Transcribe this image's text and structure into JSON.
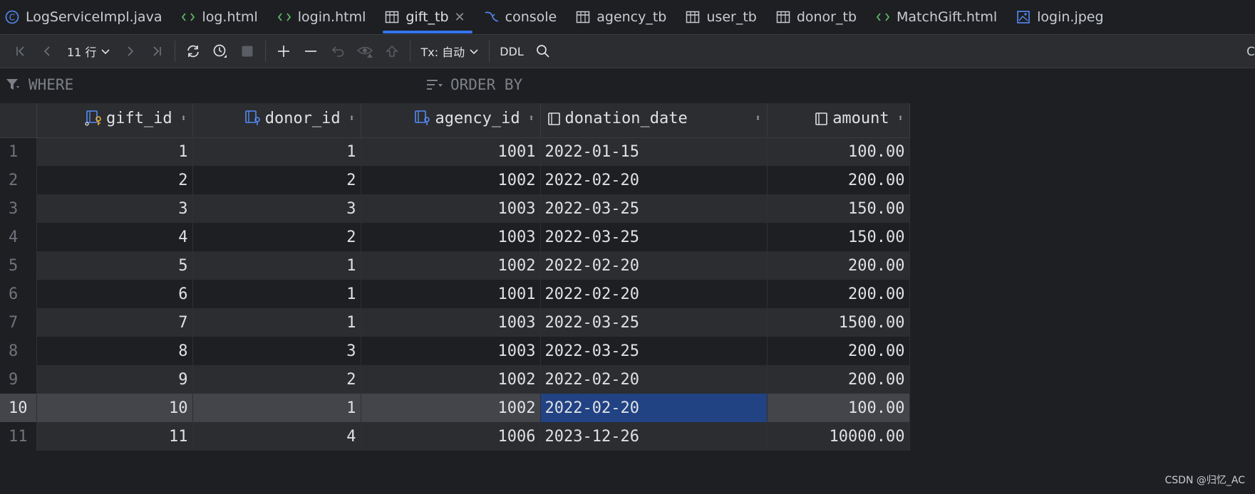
{
  "tabs": [
    {
      "label": "LogServiceImpl.java",
      "icon": "class-icon",
      "active": false
    },
    {
      "label": "log.html",
      "icon": "html-icon",
      "active": false
    },
    {
      "label": "login.html",
      "icon": "html-icon",
      "active": false
    },
    {
      "label": "gift_tb",
      "icon": "table-icon",
      "active": true
    },
    {
      "label": "console",
      "icon": "mysql-console-icon",
      "active": false
    },
    {
      "label": "agency_tb",
      "icon": "table-icon",
      "active": false
    },
    {
      "label": "user_tb",
      "icon": "table-icon",
      "active": false
    },
    {
      "label": "donor_tb",
      "icon": "table-icon",
      "active": false
    },
    {
      "label": "MatchGift.html",
      "icon": "html-icon",
      "active": false
    },
    {
      "label": "login.jpeg",
      "icon": "image-icon",
      "active": false
    }
  ],
  "toolbar": {
    "page_size": "11 行",
    "tx_mode": "Tx: 自动",
    "ddl_label": "DDL",
    "edge_text": "C"
  },
  "filters": {
    "where": "WHERE",
    "order_by": "ORDER BY"
  },
  "grid": {
    "columns": [
      {
        "name": "gift_id",
        "icon": "primary-key-column-icon"
      },
      {
        "name": "donor_id",
        "icon": "foreign-key-column-icon"
      },
      {
        "name": "agency_id",
        "icon": "foreign-key-column-icon"
      },
      {
        "name": "donation_date",
        "icon": "column-icon"
      },
      {
        "name": "amount",
        "icon": "column-icon"
      }
    ],
    "rows": [
      {
        "n": "1",
        "gift_id": "1",
        "donor_id": "1",
        "agency_id": "1001",
        "donation_date": "2022-01-15",
        "amount": "100.00"
      },
      {
        "n": "2",
        "gift_id": "2",
        "donor_id": "2",
        "agency_id": "1002",
        "donation_date": "2022-02-20",
        "amount": "200.00"
      },
      {
        "n": "3",
        "gift_id": "3",
        "donor_id": "3",
        "agency_id": "1003",
        "donation_date": "2022-03-25",
        "amount": "150.00"
      },
      {
        "n": "4",
        "gift_id": "4",
        "donor_id": "2",
        "agency_id": "1003",
        "donation_date": "2022-03-25",
        "amount": "150.00"
      },
      {
        "n": "5",
        "gift_id": "5",
        "donor_id": "1",
        "agency_id": "1002",
        "donation_date": "2022-02-20",
        "amount": "200.00"
      },
      {
        "n": "6",
        "gift_id": "6",
        "donor_id": "1",
        "agency_id": "1001",
        "donation_date": "2022-02-20",
        "amount": "200.00"
      },
      {
        "n": "7",
        "gift_id": "7",
        "donor_id": "1",
        "agency_id": "1003",
        "donation_date": "2022-03-25",
        "amount": "1500.00"
      },
      {
        "n": "8",
        "gift_id": "8",
        "donor_id": "3",
        "agency_id": "1003",
        "donation_date": "2022-03-25",
        "amount": "200.00"
      },
      {
        "n": "9",
        "gift_id": "9",
        "donor_id": "2",
        "agency_id": "1002",
        "donation_date": "2022-02-20",
        "amount": "200.00"
      },
      {
        "n": "10",
        "gift_id": "10",
        "donor_id": "1",
        "agency_id": "1002",
        "donation_date": "2022-02-20",
        "amount": "100.00"
      },
      {
        "n": "11",
        "gift_id": "11",
        "donor_id": "4",
        "agency_id": "1006",
        "donation_date": "2023-12-26",
        "amount": "10000.00"
      }
    ],
    "selected_row": 10,
    "selected_column": "donation_date"
  },
  "watermark": "CSDN @归忆_AC",
  "colors": {
    "accent": "#3574f0",
    "selection": "#214283",
    "html_icon": "#5fb865",
    "key_icon": "#e8b33a",
    "column_icon": "#548af7"
  }
}
